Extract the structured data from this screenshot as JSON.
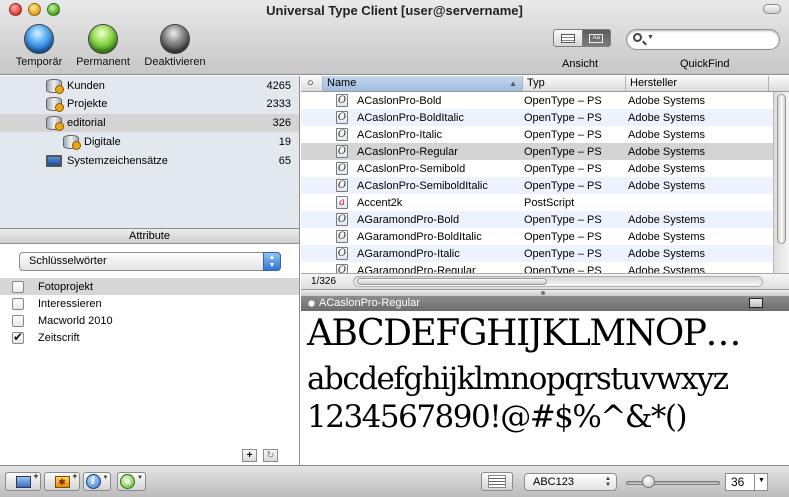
{
  "window": {
    "title": "Universal Type Client [user@servername]"
  },
  "toolbar": {
    "temporary_label": "Temporär",
    "permanent_label": "Permanent",
    "deactivate_label": "Deaktivieren",
    "view_label": "Ansicht",
    "quickfind_label": "QuickFind",
    "search_value": "",
    "colors": {
      "temporary": "#2a7fe0",
      "permanent": "#6cc535",
      "deactivate": "#5e5e5e"
    }
  },
  "sources": [
    {
      "name": "Kunden",
      "count": "4265",
      "icon": "database-icon"
    },
    {
      "name": "Projekte",
      "count": "2333",
      "icon": "database-icon"
    },
    {
      "name": "editorial",
      "count": "326",
      "icon": "database-icon",
      "selected": true
    },
    {
      "name": "Digitale",
      "count": "19",
      "icon": "database-icon"
    },
    {
      "name": "Systemzeichensätze",
      "count": "65",
      "icon": "monitor-icon"
    }
  ],
  "attributes": {
    "header": "Attribute",
    "selected_option": "Schlüsselwörter",
    "keywords": [
      {
        "label": "Fotoprojekt",
        "checked": false
      },
      {
        "label": "Interessieren",
        "checked": false
      },
      {
        "label": "Macworld 2010",
        "checked": false
      },
      {
        "label": "Zeitscrift",
        "checked": true
      }
    ],
    "add_label": "+"
  },
  "font_list": {
    "columns": [
      "Name",
      "Typ",
      "Hersteller"
    ],
    "rows": [
      {
        "name": "ACaslonPro-Bold",
        "type": "OpenType – PS",
        "maker": "Adobe Systems",
        "icon": "O"
      },
      {
        "name": "ACaslonPro-BoldItalic",
        "type": "OpenType – PS",
        "maker": "Adobe Systems",
        "icon": "O"
      },
      {
        "name": "ACaslonPro-Italic",
        "type": "OpenType – PS",
        "maker": "Adobe Systems",
        "icon": "O"
      },
      {
        "name": "ACaslonPro-Regular",
        "type": "OpenType – PS",
        "maker": "Adobe Systems",
        "icon": "O"
      },
      {
        "name": "ACaslonPro-Semibold",
        "type": "OpenType – PS",
        "maker": "Adobe Systems",
        "icon": "O"
      },
      {
        "name": "ACaslonPro-SemiboldItalic",
        "type": "OpenType – PS",
        "maker": "Adobe Systems",
        "icon": "O"
      },
      {
        "name": "Accent2k",
        "type": "PostScript",
        "maker": "",
        "icon": "a"
      },
      {
        "name": "AGaramondPro-Bold",
        "type": "OpenType – PS",
        "maker": "Adobe Systems",
        "icon": "O"
      },
      {
        "name": "AGaramondPro-BoldItalic",
        "type": "OpenType – PS",
        "maker": "Adobe Systems",
        "icon": "O"
      },
      {
        "name": "AGaramondPro-Italic",
        "type": "OpenType – PS",
        "maker": "Adobe Systems",
        "icon": "O"
      },
      {
        "name": "AGaramondPro-Regular",
        "type": "OpenType – PS",
        "maker": "Adobe Systems",
        "icon": "O"
      }
    ],
    "selected_index": 3,
    "count_label": "1/326"
  },
  "preview": {
    "font_name": "ACaslonPro-Regular",
    "line1": "ABCDEFGHIJKLMNOP…",
    "line2": "abcdefghijklmnopqrstuvwxyz",
    "line3": "1234567890!@#$%^&*()"
  },
  "bottom": {
    "sample_text": "ABC123",
    "size_value": "36",
    "size_slider_fraction": 0.2
  }
}
